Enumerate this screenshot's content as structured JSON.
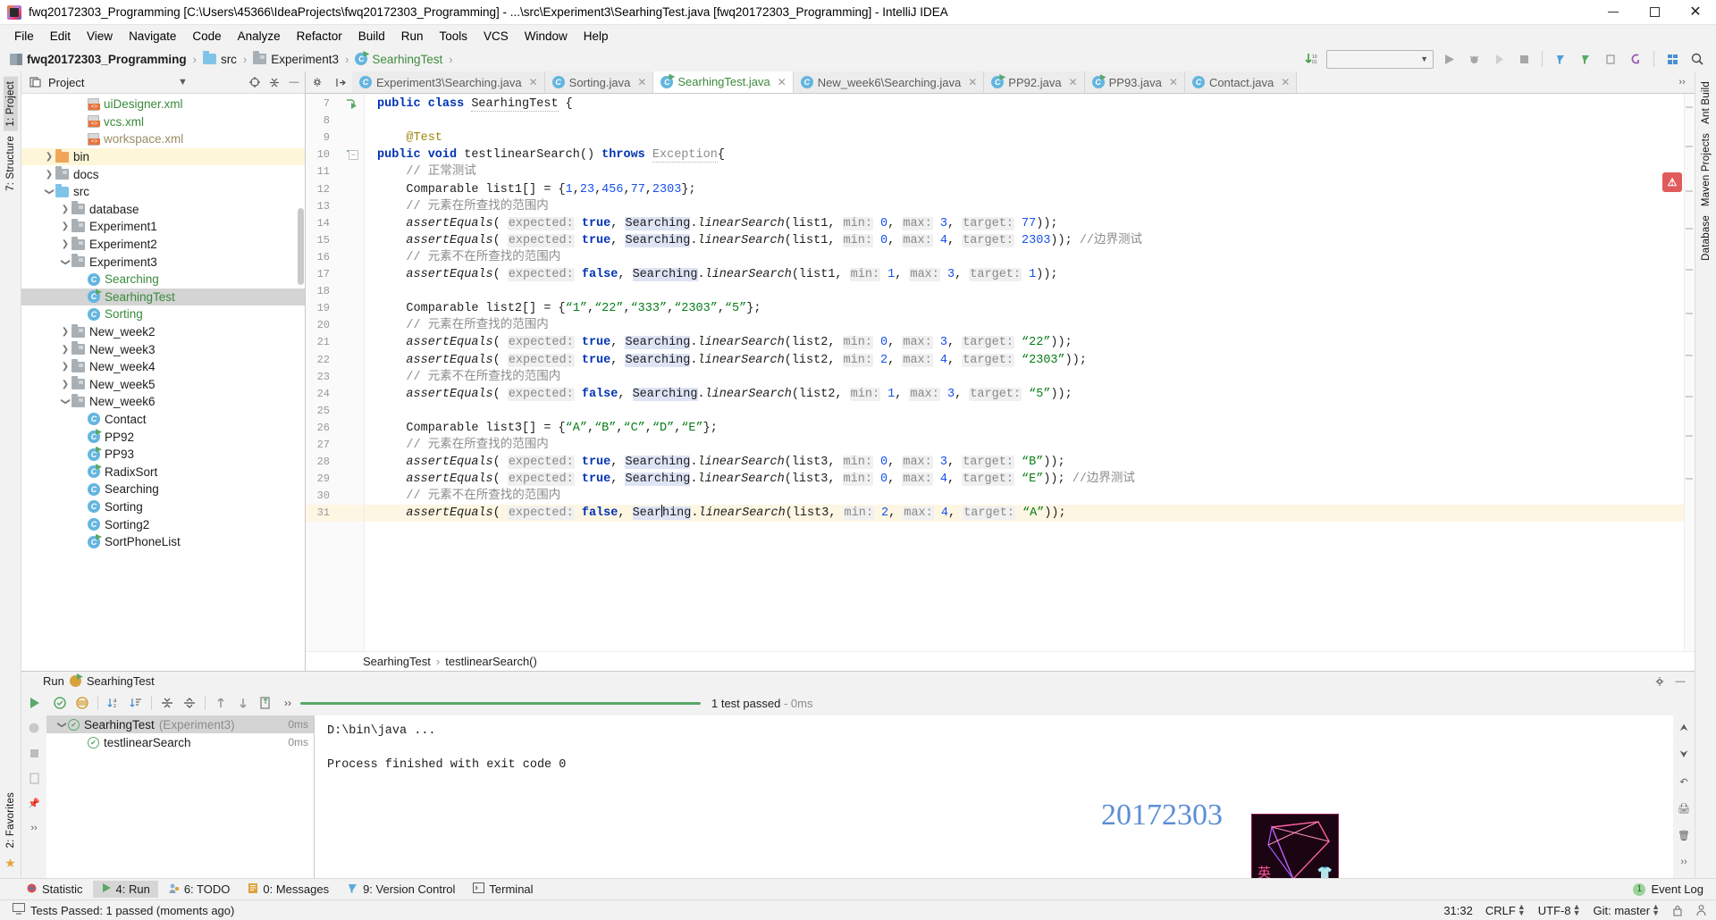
{
  "window": {
    "title": "fwq20172303_Programming [C:\\Users\\45366\\IdeaProjects\\fwq20172303_Programming] - ...\\src\\Experiment3\\SearhingTest.java [fwq20172303_Programming] - IntelliJ IDEA",
    "minimize": "—",
    "maximize": "❐",
    "close": "✕"
  },
  "menubar": {
    "items": [
      "File",
      "Edit",
      "View",
      "Navigate",
      "Code",
      "Analyze",
      "Refactor",
      "Build",
      "Run",
      "Tools",
      "VCS",
      "Window",
      "Help"
    ]
  },
  "navbar": {
    "crumbs": [
      {
        "label": "fwq20172303_Programming",
        "icon": "module-icon",
        "style": "bold"
      },
      {
        "label": "src",
        "icon": "folder-blue-icon",
        "style": "normal"
      },
      {
        "label": "Experiment3",
        "icon": "folder-gray-icon",
        "style": "normal"
      },
      {
        "label": "SearhingTest",
        "icon": "class-icon",
        "style": "green"
      }
    ],
    "separator": "›",
    "run_config_placeholder": ""
  },
  "project_pane": {
    "title": "Project",
    "tree": [
      {
        "label": "uiDesigner.xml",
        "icon": "xml-file-icon",
        "indent": 3,
        "arrow": "none",
        "color": "green"
      },
      {
        "label": "vcs.xml",
        "icon": "xml-file-icon",
        "indent": 3,
        "arrow": "none",
        "color": "green"
      },
      {
        "label": "workspace.xml",
        "icon": "xml-file-icon",
        "indent": 3,
        "arrow": "none",
        "color": "gold"
      },
      {
        "label": "bin",
        "icon": "folder-orange-icon",
        "indent": 1,
        "arrow": "right",
        "color": "normal",
        "highlight": true
      },
      {
        "label": "docs",
        "icon": "folder-gray-icon",
        "indent": 1,
        "arrow": "right",
        "color": "normal"
      },
      {
        "label": "src",
        "icon": "folder-blue-icon",
        "indent": 1,
        "arrow": "down",
        "color": "normal"
      },
      {
        "label": "database",
        "icon": "folder-gray-icon",
        "indent": 2,
        "arrow": "right",
        "color": "normal"
      },
      {
        "label": "Experiment1",
        "icon": "folder-gray-icon",
        "indent": 2,
        "arrow": "right",
        "color": "normal"
      },
      {
        "label": "Experiment2",
        "icon": "folder-gray-icon",
        "indent": 2,
        "arrow": "right",
        "color": "normal"
      },
      {
        "label": "Experiment3",
        "icon": "folder-gray-icon",
        "indent": 2,
        "arrow": "down",
        "color": "normal"
      },
      {
        "label": "Searching",
        "icon": "class-icon",
        "indent": 3,
        "arrow": "none",
        "color": "green"
      },
      {
        "label": "SearhingTest",
        "icon": "class-runnable-icon",
        "indent": 3,
        "arrow": "none",
        "color": "green",
        "selected": true
      },
      {
        "label": "Sorting",
        "icon": "class-icon",
        "indent": 3,
        "arrow": "none",
        "color": "green"
      },
      {
        "label": "New_week2",
        "icon": "folder-gray-icon",
        "indent": 2,
        "arrow": "right",
        "color": "normal"
      },
      {
        "label": "New_week3",
        "icon": "folder-gray-icon",
        "indent": 2,
        "arrow": "right",
        "color": "normal"
      },
      {
        "label": "New_week4",
        "icon": "folder-gray-icon",
        "indent": 2,
        "arrow": "right",
        "color": "normal"
      },
      {
        "label": "New_week5",
        "icon": "folder-gray-icon",
        "indent": 2,
        "arrow": "right",
        "color": "normal"
      },
      {
        "label": "New_week6",
        "icon": "folder-gray-icon",
        "indent": 2,
        "arrow": "down",
        "color": "normal"
      },
      {
        "label": "Contact",
        "icon": "class-icon",
        "indent": 3,
        "arrow": "none",
        "color": "normal"
      },
      {
        "label": "PP92",
        "icon": "class-runnable-icon",
        "indent": 3,
        "arrow": "none",
        "color": "normal"
      },
      {
        "label": "PP93",
        "icon": "class-runnable-icon",
        "indent": 3,
        "arrow": "none",
        "color": "normal"
      },
      {
        "label": "RadixSort",
        "icon": "class-runnable-icon",
        "indent": 3,
        "arrow": "none",
        "color": "normal"
      },
      {
        "label": "Searching",
        "icon": "class-icon",
        "indent": 3,
        "arrow": "none",
        "color": "normal"
      },
      {
        "label": "Sorting",
        "icon": "class-icon",
        "indent": 3,
        "arrow": "none",
        "color": "normal"
      },
      {
        "label": "Sorting2",
        "icon": "class-icon",
        "indent": 3,
        "arrow": "none",
        "color": "normal"
      },
      {
        "label": "SortPhoneList",
        "icon": "class-runnable-icon",
        "indent": 3,
        "arrow": "none",
        "color": "normal"
      }
    ]
  },
  "left_rail": {
    "tabs": [
      "1: Project",
      "7: Structure"
    ]
  },
  "right_rail": {
    "tabs": [
      "Ant Build",
      "Maven Projects",
      "Database"
    ]
  },
  "editor": {
    "tabs": [
      {
        "label": "Experiment3\\Searching.java",
        "icon": "class-icon",
        "active": false
      },
      {
        "label": "Sorting.java",
        "icon": "class-icon",
        "active": false
      },
      {
        "label": "SearhingTest.java",
        "icon": "class-runnable-icon",
        "active": true
      },
      {
        "label": "New_week6\\Searching.java",
        "icon": "class-icon",
        "active": false
      },
      {
        "label": "PP92.java",
        "icon": "class-runnable-icon",
        "active": false
      },
      {
        "label": "PP93.java",
        "icon": "class-runnable-icon",
        "active": false
      },
      {
        "label": "Contact.java",
        "icon": "class-icon",
        "active": false
      }
    ],
    "close_glyph": "✕",
    "first_line_number": 7,
    "lines": [
      {
        "n": 7,
        "html": "<span class=\"kw\">public class</span> <span class=\"cls err-ul\">SearhingTest</span> {",
        "gutterRun": true
      },
      {
        "n": 8,
        "html": ""
      },
      {
        "n": 9,
        "html": "    <span class=\"ann\">@Test</span>"
      },
      {
        "n": 10,
        "html": "<span class=\"kw\">public void</span> <span class=\"cls\">testlinearSearch</span>() <span class=\"kw\">throws</span> <span class=\"cmt err-ul\">Exception</span>{",
        "gutterRun": true,
        "gutterFold": true
      },
      {
        "n": 11,
        "html": "    <span class=\"cmt\">// 正常测试</span>"
      },
      {
        "n": 12,
        "html": "    Comparable list1[] = {<span class=\"num\">1</span>,<span class=\"num\">23</span>,<span class=\"num\">456</span>,<span class=\"num\">77</span>,<span class=\"num\">2303</span>};"
      },
      {
        "n": 13,
        "html": "    <span class=\"cmt\">// 元素在所查找的范围内</span>"
      },
      {
        "n": 14,
        "html": "    <span class=\"ital\">assertEquals</span>( <span class=\"hint-bg\">expected:</span> <span class=\"kw\">true</span>, <span class=\"ident-hl\">Searching</span>.<span class=\"ital\">linearSearch</span>(list1, <span class=\"hint-bg\">min:</span> <span class=\"num\">0</span>, <span class=\"hint-bg\">max:</span> <span class=\"num\">3</span>, <span class=\"hint-bg\">target:</span> <span class=\"num\">77</span>));"
      },
      {
        "n": 15,
        "html": "    <span class=\"ital\">assertEquals</span>( <span class=\"hint-bg\">expected:</span> <span class=\"kw\">true</span>, <span class=\"ident-hl\">Searching</span>.<span class=\"ital\">linearSearch</span>(list1, <span class=\"hint-bg\">min:</span> <span class=\"num\">0</span>, <span class=\"hint-bg\">max:</span> <span class=\"num\">4</span>, <span class=\"hint-bg\">target:</span> <span class=\"num\">2303</span>)); <span class=\"cmt\">//边界测试</span>"
      },
      {
        "n": 16,
        "html": "    <span class=\"cmt\">// 元素不在所查找的范围内</span>"
      },
      {
        "n": 17,
        "html": "    <span class=\"ital\">assertEquals</span>( <span class=\"hint-bg\">expected:</span> <span class=\"kw\">false</span>, <span class=\"ident-hl\">Searching</span>.<span class=\"ital\">linearSearch</span>(list1, <span class=\"hint-bg\">min:</span> <span class=\"num\">1</span>, <span class=\"hint-bg\">max:</span> <span class=\"num\">3</span>, <span class=\"hint-bg\">target:</span> <span class=\"num\">1</span>));"
      },
      {
        "n": 18,
        "html": ""
      },
      {
        "n": 19,
        "html": "    Comparable list2[] = {<span class=\"str\">“1”</span>,<span class=\"str\">“22”</span>,<span class=\"str\">“333”</span>,<span class=\"str\">“2303”</span>,<span class=\"str\">“5”</span>};"
      },
      {
        "n": 20,
        "html": "    <span class=\"cmt\">// 元素在所查找的范围内</span>"
      },
      {
        "n": 21,
        "html": "    <span class=\"ital\">assertEquals</span>( <span class=\"hint-bg\">expected:</span> <span class=\"kw\">true</span>, <span class=\"ident-hl\">Searching</span>.<span class=\"ital\">linearSearch</span>(list2, <span class=\"hint-bg\">min:</span> <span class=\"num\">0</span>, <span class=\"hint-bg\">max:</span> <span class=\"num\">3</span>, <span class=\"hint-bg\">target:</span> <span class=\"str\">“22”</span>));"
      },
      {
        "n": 22,
        "html": "    <span class=\"ital\">assertEquals</span>( <span class=\"hint-bg\">expected:</span> <span class=\"kw\">true</span>, <span class=\"ident-hl\">Searching</span>.<span class=\"ital\">linearSearch</span>(list2, <span class=\"hint-bg\">min:</span> <span class=\"num\">2</span>, <span class=\"hint-bg\">max:</span> <span class=\"num\">4</span>, <span class=\"hint-bg\">target:</span> <span class=\"str\">“2303”</span>));"
      },
      {
        "n": 23,
        "html": "    <span class=\"cmt\">// 元素不在所查找的范围内</span>"
      },
      {
        "n": 24,
        "html": "    <span class=\"ital\">assertEquals</span>( <span class=\"hint-bg\">expected:</span> <span class=\"kw\">false</span>, <span class=\"ident-hl\">Searching</span>.<span class=\"ital\">linearSearch</span>(list2, <span class=\"hint-bg\">min:</span> <span class=\"num\">1</span>, <span class=\"hint-bg\">max:</span> <span class=\"num\">3</span>, <span class=\"hint-bg\">target:</span> <span class=\"str\">“5”</span>));"
      },
      {
        "n": 25,
        "html": ""
      },
      {
        "n": 26,
        "html": "    Comparable list3[] = {<span class=\"str\">“A”</span>,<span class=\"str\">“B”</span>,<span class=\"str\">“C”</span>,<span class=\"str\">“D”</span>,<span class=\"str\">“E”</span>};"
      },
      {
        "n": 27,
        "html": "    <span class=\"cmt\">// 元素在所查找的范围内</span>"
      },
      {
        "n": 28,
        "html": "    <span class=\"ital\">assertEquals</span>( <span class=\"hint-bg\">expected:</span> <span class=\"kw\">true</span>, <span class=\"ident-hl\">Searching</span>.<span class=\"ital\">linearSearch</span>(list3, <span class=\"hint-bg\">min:</span> <span class=\"num\">0</span>, <span class=\"hint-bg\">max:</span> <span class=\"num\">3</span>, <span class=\"hint-bg\">target:</span> <span class=\"str\">“B”</span>));"
      },
      {
        "n": 29,
        "html": "    <span class=\"ital\">assertEquals</span>( <span class=\"hint-bg\">expected:</span> <span class=\"kw\">true</span>, <span class=\"ident-hl\">Searching</span>.<span class=\"ital\">linearSearch</span>(list3, <span class=\"hint-bg\">min:</span> <span class=\"num\">0</span>, <span class=\"hint-bg\">max:</span> <span class=\"num\">4</span>, <span class=\"hint-bg\">target:</span> <span class=\"str\">“E”</span>)); <span class=\"cmt\">//边界测试</span>"
      },
      {
        "n": 30,
        "html": "    <span class=\"cmt\">// 元素不在所查找的范围内</span>"
      },
      {
        "n": 31,
        "html": "    <span class=\"ital\">assertEquals</span>( <span class=\"hint-bg\">expected:</span> <span class=\"kw\">false</span>, <span class=\"ident-hl\">Sear</span><span class=\"caret\"></span><span class=\"ident-hl\">hing</span>.<span class=\"ital\">linearSearch</span>(list3, <span class=\"hint-bg\">min:</span> <span class=\"num\">2</span>, <span class=\"hint-bg\">max:</span> <span class=\"num\">4</span>, <span class=\"hint-bg\">target:</span> <span class=\"str\">“A”</span>));",
        "current": true
      }
    ],
    "breadcrumb": {
      "class": "SearhingTest",
      "method": "testlinearSearch()",
      "sep": "›"
    }
  },
  "run_window": {
    "title": "Run",
    "config_name": "SearhingTest",
    "status_text": "1 test passed",
    "status_time": "- 0ms",
    "tests": [
      {
        "label": "SearhingTest",
        "suffix": "(Experiment3)",
        "time": "0ms",
        "indent": 0,
        "selected": true,
        "arrow": "down"
      },
      {
        "label": "testlinearSearch",
        "suffix": "",
        "time": "0ms",
        "indent": 1,
        "selected": false,
        "arrow": "none"
      }
    ],
    "console": [
      "D:\\bin\\java ...",
      "Process finished with exit code 0"
    ],
    "watermark": "20172303",
    "neon_text": "英"
  },
  "bottom_strip": {
    "items": [
      {
        "label": "Statistic",
        "icon": "statistic-icon",
        "active": false
      },
      {
        "label": "4: Run",
        "icon": "run-icon",
        "active": true
      },
      {
        "label": "6: TODO",
        "icon": "todo-icon",
        "active": false
      },
      {
        "label": "0: Messages",
        "icon": "messages-icon",
        "active": false
      },
      {
        "label": "9: Version Control",
        "icon": "vcs-icon",
        "active": false
      },
      {
        "label": "Terminal",
        "icon": "terminal-icon",
        "active": false
      }
    ],
    "event_log": {
      "label": "Event Log",
      "count": "1"
    }
  },
  "statusbar": {
    "message": "Tests Passed: 1 passed (moments ago)",
    "caret": "31:32",
    "line_sep": "CRLF",
    "encoding": "UTF-8",
    "branch": "Git: master"
  },
  "colors": {
    "accent_green": "#59a869",
    "keyword_blue": "#0033b3",
    "string_green": "#067d17",
    "number_blue": "#1750eb",
    "comment_gray": "#8c8c8c",
    "watermark_blue": "#5b8ed6"
  }
}
